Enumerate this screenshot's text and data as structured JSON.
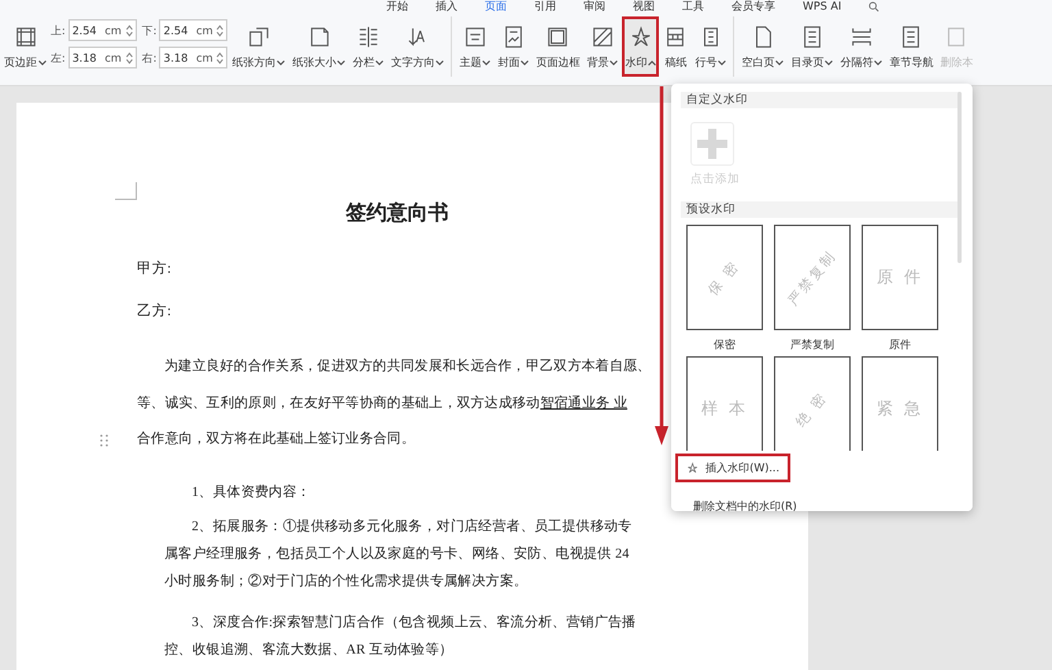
{
  "menu_tabs": [
    {
      "label": "开始",
      "selected": false
    },
    {
      "label": "插入",
      "selected": false
    },
    {
      "label": "页面",
      "selected": true
    },
    {
      "label": "引用",
      "selected": false
    },
    {
      "label": "审阅",
      "selected": false
    },
    {
      "label": "视图",
      "selected": false
    },
    {
      "label": "工具",
      "selected": false
    },
    {
      "label": "会员专享",
      "selected": false
    },
    {
      "label": "WPS AI",
      "selected": false
    }
  ],
  "tools": [
    {
      "kind": "tool",
      "label": "页边距",
      "menu": true,
      "expanded": false,
      "highlighted": false,
      "disabled": false
    },
    {
      "kind": "fields",
      "fields": [
        {
          "label": "上:",
          "value": "2.54",
          "unit": "cm"
        },
        {
          "label": "下:",
          "value": "2.54",
          "unit": "cm"
        },
        {
          "label": "左:",
          "value": "3.18",
          "unit": "cm"
        },
        {
          "label": "右:",
          "value": "3.18",
          "unit": "cm"
        }
      ]
    },
    {
      "kind": "tool",
      "label": "纸张方向",
      "menu": true,
      "expanded": false,
      "highlighted": false,
      "disabled": false
    },
    {
      "kind": "tool",
      "label": "纸张大小",
      "menu": true,
      "expanded": false,
      "highlighted": false,
      "disabled": false
    },
    {
      "kind": "tool",
      "label": "分栏",
      "menu": true,
      "expanded": false,
      "highlighted": false,
      "disabled": false
    },
    {
      "kind": "tool",
      "label": "文字方向",
      "menu": true,
      "expanded": false,
      "highlighted": false,
      "disabled": false
    },
    {
      "kind": "separator"
    },
    {
      "kind": "tool",
      "label": "主题",
      "menu": true,
      "expanded": false,
      "highlighted": false,
      "disabled": false
    },
    {
      "kind": "tool",
      "label": "封面",
      "menu": true,
      "expanded": false,
      "highlighted": false,
      "disabled": false
    },
    {
      "kind": "tool",
      "label": "页面边框",
      "menu": false,
      "highlighted": false,
      "disabled": false
    },
    {
      "kind": "tool",
      "label": "背景",
      "menu": true,
      "expanded": false,
      "highlighted": false,
      "disabled": false
    },
    {
      "kind": "tool",
      "label": "水印",
      "menu": true,
      "expanded": true,
      "highlighted": true,
      "disabled": false
    },
    {
      "kind": "tool",
      "label": "稿纸",
      "menu": false,
      "highlighted": false,
      "disabled": false
    },
    {
      "kind": "tool",
      "label": "行号",
      "menu": true,
      "expanded": false,
      "highlighted": false,
      "disabled": false
    },
    {
      "kind": "separator"
    },
    {
      "kind": "tool",
      "label": "空白页",
      "menu": true,
      "expanded": false,
      "highlighted": false,
      "disabled": false
    },
    {
      "kind": "tool",
      "label": "目录页",
      "menu": true,
      "expanded": false,
      "highlighted": false,
      "disabled": false
    },
    {
      "kind": "tool",
      "label": "分隔符",
      "menu": true,
      "expanded": false,
      "highlighted": false,
      "disabled": false
    },
    {
      "kind": "tool",
      "label": "章节导航",
      "menu": false,
      "highlighted": false,
      "disabled": false
    },
    {
      "kind": "tool",
      "label": "删除本",
      "menu": false,
      "highlighted": false,
      "disabled": true
    }
  ],
  "document": {
    "title": "签约意向书",
    "parties": [
      "甲方:",
      "乙方:"
    ],
    "intro": [
      {
        "text": "为建立良好的合作关系，促进双方的共同发展和长远合作，甲乙双方本着自愿、"
      },
      {
        "text": "等、诚实、互利的原则，在友好平等协商的基础上，双方达成移动",
        "underline": "智宿通业务  业"
      },
      {
        "text": "合作意向，双方将在此基础上签订业务合同。"
      }
    ],
    "items": [
      {
        "lines": [
          "1、具体资费内容："
        ]
      },
      {
        "lines": [
          "2、拓展服务：①提供移动多元化服务，对门店经营者、员工提供移动专",
          "属客户经理服务，包括员工个人以及家庭的号卡、网络、安防、电视提供 24",
          "小时服务制；②对于门店的个性化需求提供专属解决方案。"
        ]
      },
      {
        "lines": [
          "3、深度合作:探索智慧门店合作（包含视频上云、客流分析、营销广告播",
          "控、收银追溯、客流大数据、AR 互动体验等）"
        ]
      }
    ]
  },
  "watermark_menu": {
    "custom_header": "自定义水印",
    "add_tile": {
      "label": "点击添加",
      "disabled": true
    },
    "preset_header": "预设水印",
    "presets": [
      {
        "preview": "保 密",
        "label": "保密",
        "rotated": true
      },
      {
        "preview": "严禁复制",
        "label": "严禁复制",
        "rotated": true
      },
      {
        "preview": "原 件",
        "label": "原件",
        "rotated": false
      },
      {
        "preview": "样 本",
        "rotated": false
      },
      {
        "preview": "绝 密",
        "rotated": true
      },
      {
        "preview": "紧 急",
        "rotated": false
      }
    ],
    "actions": [
      {
        "label": "插入水印(W)...",
        "highlighted": true
      },
      {
        "label": "删除文档中的水印(R)",
        "highlighted": false
      }
    ]
  }
}
